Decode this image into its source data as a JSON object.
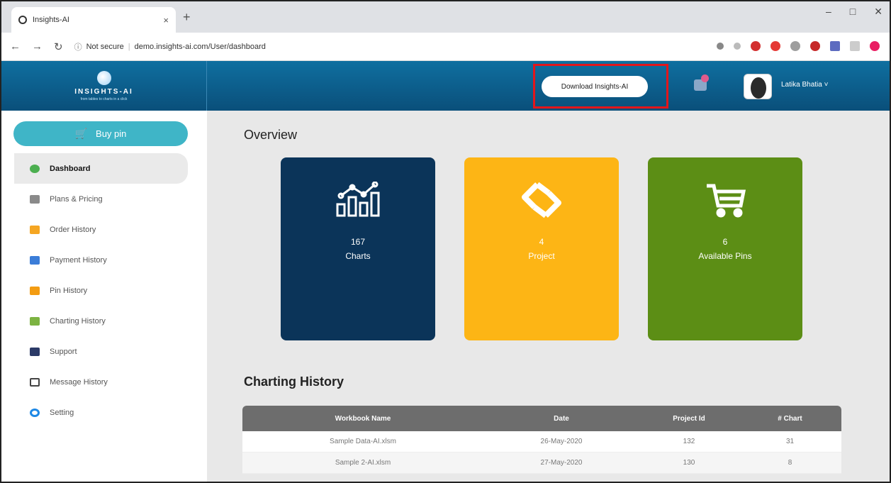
{
  "browser": {
    "tab_title": "Insights-AI",
    "tab_close": "×",
    "new_tab": "+",
    "security_label": "Not secure",
    "url": "demo.insights-ai.com/User/dashboard",
    "win_minimize": "–",
    "win_maximize": "□",
    "win_close": "✕"
  },
  "app": {
    "logo_text": "INSIGHTS-AI",
    "logo_tagline": "from tables to charts in a click",
    "download_label": "Download Insights-AI",
    "user_name": "Latika Bhatia ˅"
  },
  "sidebar": {
    "buy_pin_label": "Buy pin",
    "items": [
      {
        "label": "Dashboard",
        "color": "#4caf50"
      },
      {
        "label": "Plans & Pricing",
        "color": "#8a8a8a"
      },
      {
        "label": "Order History",
        "color": "#f5a623"
      },
      {
        "label": "Payment History",
        "color": "#3b7dd8"
      },
      {
        "label": "Pin History",
        "color": "#f39c12"
      },
      {
        "label": "Charting History",
        "color": "#7cb342"
      },
      {
        "label": "Support",
        "color": "#2b3a67"
      },
      {
        "label": "Message History",
        "color": "#444444"
      },
      {
        "label": "Setting",
        "color": "#1e88e5"
      }
    ]
  },
  "overview": {
    "title": "Overview",
    "cards": [
      {
        "value": "167",
        "label": "Charts",
        "color": "#0b3459"
      },
      {
        "value": "4",
        "label": "Project",
        "color": "#fdb515"
      },
      {
        "value": "6",
        "label": "Available Pins",
        "color": "#5c8e15"
      }
    ]
  },
  "history": {
    "title": "Charting History",
    "headers": [
      "Workbook Name",
      "Date",
      "Project Id",
      "# Chart"
    ],
    "rows": [
      [
        "Sample Data-AI.xlsm",
        "26-May-2020",
        "132",
        "31"
      ],
      [
        "Sample 2-AI.xlsm",
        "27-May-2020",
        "130",
        "8"
      ]
    ]
  }
}
